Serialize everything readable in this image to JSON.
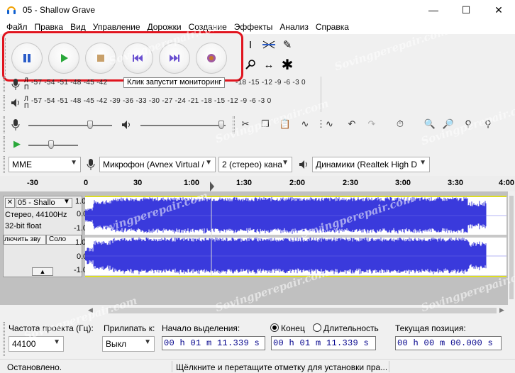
{
  "window": {
    "title": "05 - Shallow Grave",
    "minimize": "—",
    "maximize": "☐",
    "close": "✕"
  },
  "menu": [
    "Файл",
    "Правка",
    "Вид",
    "Управление",
    "Дорожки",
    "Создание",
    "Эффекты",
    "Анализ",
    "Справка"
  ],
  "transport": {
    "pause": "pause-icon",
    "play": "play-icon",
    "stop": "stop-icon",
    "skip_start": "skip-to-start-icon",
    "skip_end": "skip-to-end-icon",
    "record": "record-icon",
    "highlight_color": "#e0141e"
  },
  "meters": {
    "record_scale": "-57 -54 -51 -48 -45 -42",
    "record_tooltip": "Клик запустит мониторинг",
    "record_scale_right": "-18 -15 -12 -9 -6 -3 0",
    "play_scale": "-57 -54 -51 -48 -45 -42 -39 -36 -33 -30 -27 -24 -21 -18 -15 -12 -9 -6 -3 0",
    "L": "Л",
    "R": "П"
  },
  "devices": {
    "host": "MME",
    "input": "Микрофон (Avnex Virtual /",
    "channels": "2 (стерео) кана",
    "output": "Динамики (Realtek High D"
  },
  "timeline": [
    "-30",
    "0",
    "30",
    "1:00",
    "1:30",
    "2:00",
    "2:30",
    "3:00",
    "3:30",
    "4:00"
  ],
  "track": {
    "name": "05 - Shallo",
    "info1": "Стерео, 44100Hz",
    "info2": "32-bit float",
    "mute": "лючить зву",
    "solo": "Соло",
    "scale": [
      "1.0",
      "0.0",
      "-1.0"
    ],
    "wave_color": "#3a3adc"
  },
  "selection": {
    "rate_label": "Частота проекта (Гц):",
    "rate_value": "44100",
    "snap_label": "Прилипать к:",
    "snap_value": "Выкл",
    "start_label": "Начало выделения:",
    "start_value": "00 h 01 m 11.339 s",
    "end_label": "Конец",
    "length_label": "Длительность",
    "end_value": "00 h 01 m 11.339 s",
    "pos_label": "Текущая позиция:",
    "pos_value": "00 h 00 m 00.000 s"
  },
  "status": {
    "left": "Остановлено.",
    "right": "Щёлкните и перетащите отметку для установки пра..."
  },
  "watermark": "Sovingperepair.com"
}
